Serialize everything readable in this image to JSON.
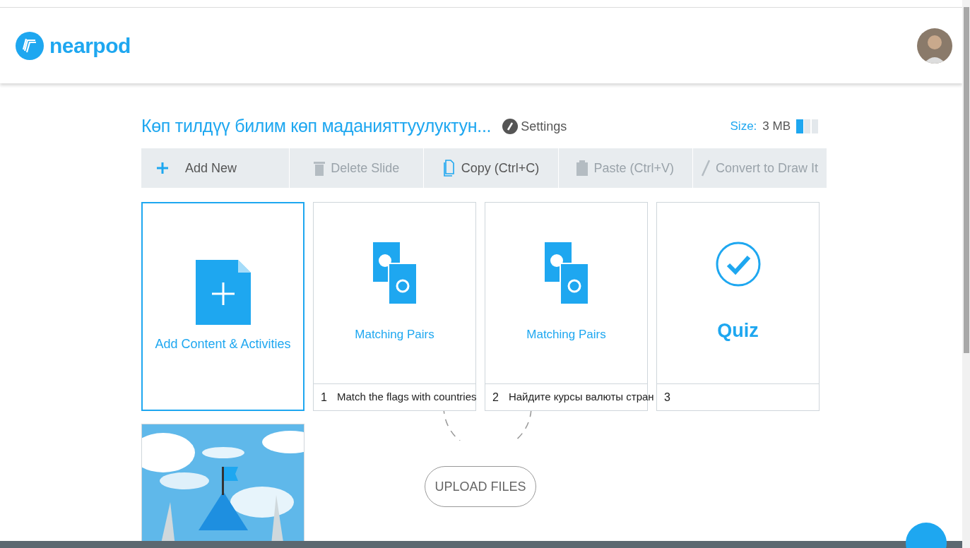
{
  "header": {
    "logo": "nearpod"
  },
  "presentation": {
    "title": "Көп тилдүү билим көп маданияттуулуктун...",
    "settings": "Settings",
    "size_label": "Size:",
    "size_value": "3 MB",
    "storage_meter": {
      "level": 0.33
    }
  },
  "toolbar": [
    {
      "label": "Add New",
      "disabled": false
    },
    {
      "label": "Delete Slide",
      "disabled": true
    },
    {
      "label": "Copy (Ctrl+C)",
      "disabled": false
    },
    {
      "label": "Paste (Ctrl+V)",
      "disabled": true
    },
    {
      "label": "Convert to Draw It",
      "disabled": true
    }
  ],
  "add_tile": {
    "label": "Add Content & Activities"
  },
  "slides": [
    {
      "kind": "matching",
      "title": "Matching Pairs",
      "number": "1",
      "caption": "Match the flags with countries"
    },
    {
      "kind": "matching",
      "title": "Matching Pairs",
      "number": "2",
      "caption": "Найдите курсы валюты стран"
    },
    {
      "kind": "quiz",
      "title": "Quiz",
      "number": "3"
    },
    {
      "kind": "picture"
    }
  ],
  "upload": {
    "label": "UPLOAD FILES"
  }
}
